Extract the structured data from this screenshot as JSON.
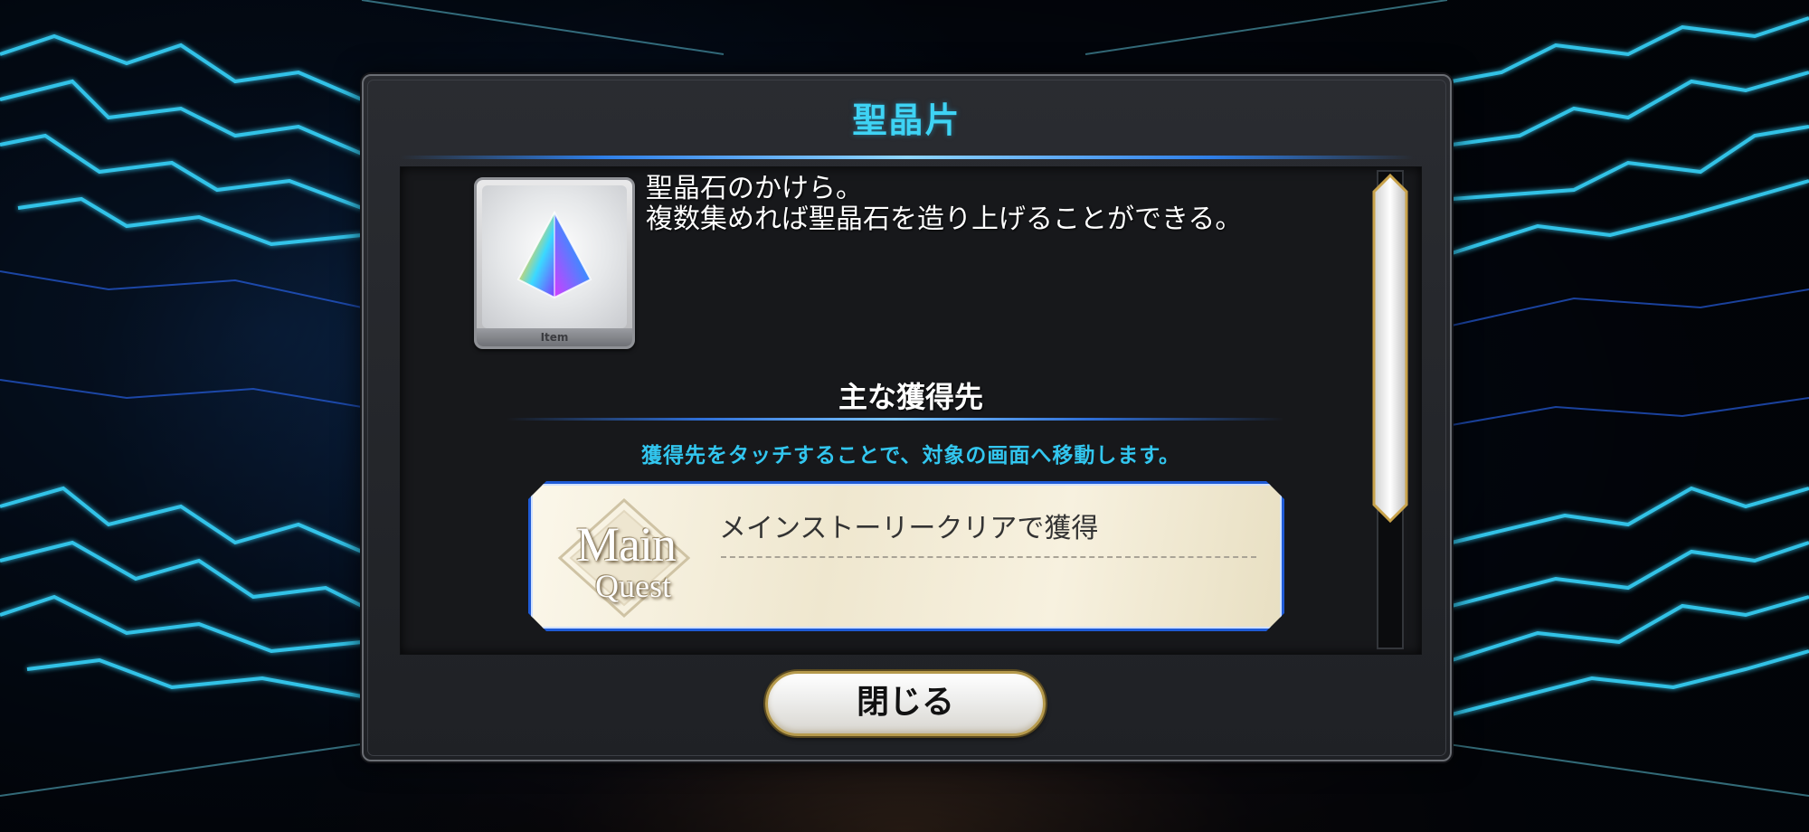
{
  "dialog": {
    "title": "聖晶片",
    "item": {
      "card_label": "Item",
      "icon": "rainbow-crystal-pyramid-icon",
      "description_lines": [
        "聖晶石のかけら。",
        "複数集めれば聖晶石を造り上げることができる。"
      ]
    },
    "sources": {
      "heading": "主な獲得先",
      "hint": "獲得先をタッチすることで、対象の画面へ移動します。",
      "items": [
        {
          "emblem_line1": "Main",
          "emblem_line2": "Quest",
          "text": "メインストーリークリアで獲得"
        }
      ]
    },
    "close_label": "閉じる"
  },
  "colors": {
    "title": "#3ed3f4",
    "hint": "#32c6ef",
    "source_border": "#1f5bd6",
    "panel": "#17181b"
  }
}
